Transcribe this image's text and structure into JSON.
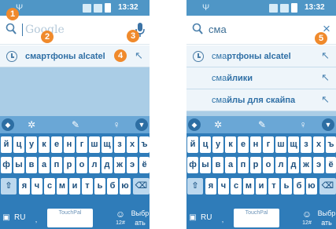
{
  "colors": {
    "status_bar": "#4f96c6",
    "accent": "#2f73a8",
    "callout": "#f08a2c",
    "keyboard": "#2f7cb9",
    "suggestion_bg": "#eef5fa"
  },
  "status_bar": {
    "time": "13:32",
    "usb_glyph": "Ψ"
  },
  "left": {
    "search": {
      "placeholder": "Google",
      "mic_icon": "mic-icon"
    },
    "suggestions": [
      {
        "text": "смартфоны alcatel",
        "icon": "clock-icon"
      }
    ],
    "callouts": [
      "1",
      "2",
      "3",
      "4"
    ]
  },
  "right": {
    "search": {
      "value": "сма",
      "clear_icon": "×"
    },
    "suggestions": [
      {
        "prefix": "сма",
        "rest": "ртфоны alcatel",
        "icon": "clock-icon"
      },
      {
        "prefix": "сма",
        "rest": "йлики"
      },
      {
        "prefix": "сма",
        "rest": "йлы для скайпа"
      }
    ],
    "callouts": [
      "5"
    ]
  },
  "suggestion_arrow": "↖",
  "keyboard": {
    "row1": [
      "й",
      "ц",
      "у",
      "к",
      "е",
      "н",
      "г",
      "ш",
      "щ",
      "з",
      "х",
      "ъ"
    ],
    "row2": [
      "ф",
      "ы",
      "в",
      "а",
      "п",
      "р",
      "о",
      "л",
      "д",
      "ж",
      "э",
      "ё"
    ],
    "row3": [
      "я",
      "ч",
      "с",
      "м",
      "и",
      "т",
      "ь",
      "б",
      "ю"
    ],
    "shift": "⇧",
    "backspace": "⌫",
    "lang": "RU",
    "comma": ",",
    "space_label": "TouchPal",
    "smiley": "☺",
    "numeric": "12#",
    "action": "Выбрать",
    "toolbar": {
      "logo": "◆",
      "settings": "✲",
      "edit": "✎",
      "mic": "♀",
      "hide": "▼"
    }
  }
}
